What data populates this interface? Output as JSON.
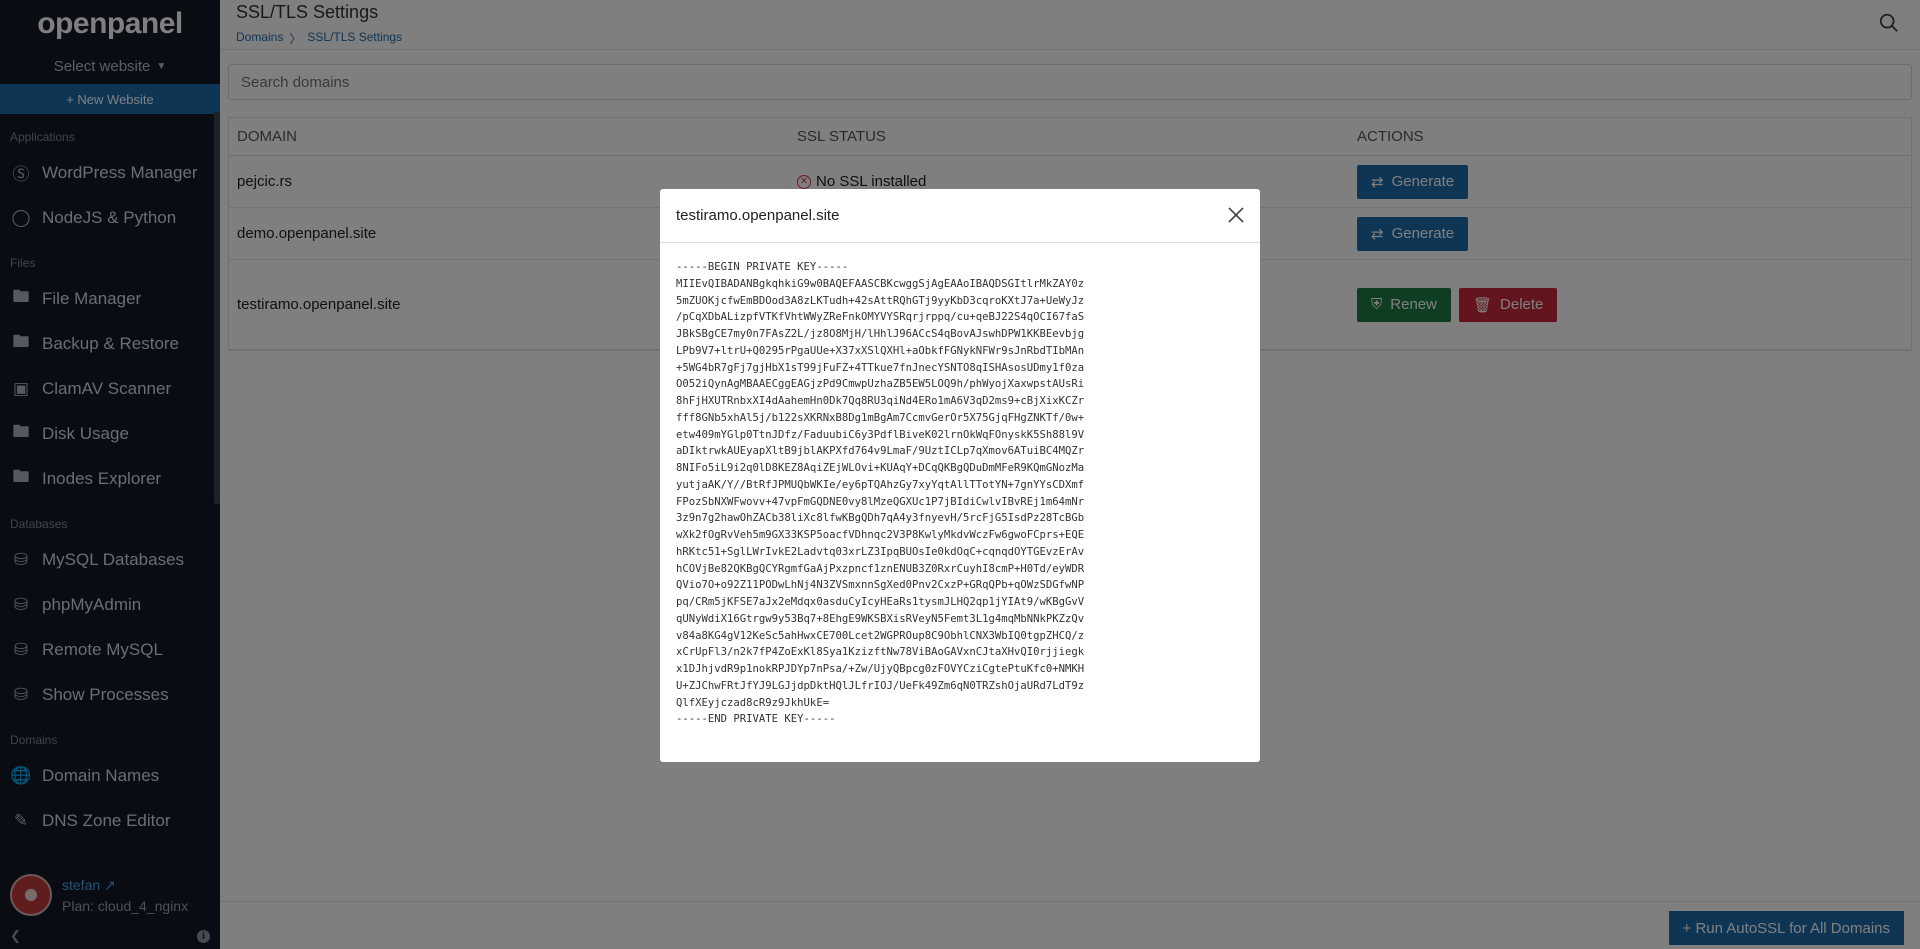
{
  "app": {
    "name": "openpanel"
  },
  "sidebar": {
    "select_label": "Select website",
    "new_website": "+ New Website",
    "sections": [
      {
        "title": "Applications",
        "items": [
          {
            "label": "WordPress Manager",
            "icon": "wordpress-icon"
          },
          {
            "label": "NodeJS & Python",
            "icon": "nodejs-icon"
          }
        ]
      },
      {
        "title": "Files",
        "items": [
          {
            "label": "File Manager",
            "icon": "folder-icon"
          },
          {
            "label": "Backup & Restore",
            "icon": "folder-icon"
          },
          {
            "label": "ClamAV Scanner",
            "icon": "scanner-icon"
          },
          {
            "label": "Disk Usage",
            "icon": "folder-icon"
          },
          {
            "label": "Inodes Explorer",
            "icon": "folder-icon"
          }
        ]
      },
      {
        "title": "Databases",
        "items": [
          {
            "label": "MySQL Databases",
            "icon": "database-icon"
          },
          {
            "label": "phpMyAdmin",
            "icon": "database-icon"
          },
          {
            "label": "Remote MySQL",
            "icon": "database-icon"
          },
          {
            "label": "Show Processes",
            "icon": "database-icon"
          }
        ]
      },
      {
        "title": "Domains",
        "items": [
          {
            "label": "Domain Names",
            "icon": "globe-icon"
          },
          {
            "label": "DNS Zone Editor",
            "icon": "edit-icon"
          }
        ]
      }
    ],
    "user": {
      "name": "stefan",
      "plan": "Plan: cloud_4_nginx"
    }
  },
  "header": {
    "title": "SSL/TLS Settings",
    "breadcrumb": [
      "Domains",
      "SSL/TLS Settings"
    ],
    "breadcrumb_sep": "〉"
  },
  "search": {
    "placeholder": "Search domains"
  },
  "table": {
    "headers": [
      "DOMAIN",
      "SSL STATUS",
      "ACTIONS"
    ],
    "rows": [
      {
        "domain": "pejcic.rs",
        "status": "No SSL installed",
        "actions": [
          "Generate"
        ]
      },
      {
        "domain": "demo.openpanel.site",
        "status": "",
        "actions": [
          "Generate"
        ]
      },
      {
        "domain": "testiramo.openpanel.site",
        "status": "",
        "actions": [
          "Renew",
          "Delete"
        ]
      }
    ]
  },
  "autossl_button": "+ Run AutoSSL for All Domains",
  "modal": {
    "title": "testiramo.openpanel.site",
    "key_lines": [
      "-----BEGIN PRIVATE KEY-----",
      "MIIEvQIBADANBgkqhkiG9w0BAQEFAASCBKcwggSjAgEAAoIBAQDSGItlrMkZAY0z",
      "5mZUOKjcfwEmBDOod3A8zLKTudh+42sAttRQhGTj9yyKbD3cqroKXtJ7a+UeWyJz",
      "/pCqXDbALizpfVTKfVhtWWyZReFnkOMYVYSRqrjrppq/cu+qeBJ22S4qOCI67faS",
      "JBkSBgCE7my0n7FAsZ2L/jz8O8MjH/lHhlJ96ACcS4qBovAJswhDPW1KKBEevbjg",
      "LPb9V7+ltrU+Q0295rPgaUUe+X37xXSlQXHl+aObkfFGNykNFWr9sJnRbdTIbMAn",
      "+5WG4bR7gFj7gjHbX1sT99jFuFZ+4TTkue7fnJnecYSNTO8qISHAsosUDmy1f0za",
      "O052iQynAgMBAAECggEAGjzPd9CmwpUzhaZB5EW5LOQ9h/phWyojXaxwpstAUsRi",
      "8hFjHXUTRnbxXI4dAahemHn0Dk7Qq8RU3qiNd4ERo1mA6V3qD2ms9+cBjXixKCZr",
      "fff8GNb5xhAl5j/b122sXKRNxB8Dg1mBgAm7CcmvGerOr5X75GjqFHgZNKTf/0w+",
      "etw409mYGlp0TtnJDfz/FaduubiC6y3PdflBiveK02lrnOkWqFOnyskK5Sh88l9V",
      "aDIktrwkAUEyapXltB9jblAKPXfd764v9LmaF/9UztICLp7qXmov6ATuiBC4MQZr",
      "8NIFo5iL9i2q0lD8KEZ8AqiZEjWLOvi+KUAqY+DCqQKBgQDuDmMFeR9KQmGNozMa",
      "yutjaAK/Y//BtRfJPMUQbWKIe/ey6pTQAhzGy7xyYqtAllTTotYN+7gnYYsCDXmf",
      "FPozSbNXWFwovv+47vpFmGQDNE0vy8lMzeQGXUc1P7jBIdiCwlvIBvREj1m64mNr",
      "3z9n7g2hawOhZACb38liXc8lfwKBgQDh7qA4y3fnyevH/5rcFjG5IsdPz28TcBGb",
      "wXk2fOgRvVeh5m9GX33KSP5oacfVDhnqc2V3P8KwlyMkdvWczFw6gwoFCprs+EQE",
      "hRKtc51+SglLWrIvkE2Ladvtq03xrLZ3IpqBUOsIe0kdOqC+cqnqdOYTGEvzErAv",
      "hCOVjBe82QKBgQCYRgmfGaAjPxzpncf1znENUB3Z0RxrCuyhI8cmP+H0Td/eyWDR",
      "QVio7O+o92Z11PODwLhNj4N3ZVSmxnnSgXed0Pnv2CxzP+GRqQPb+qOWzSDGfwNP",
      "pq/CRm5jKFSE7aJx2eMdqx0asduCyIcyHEaRs1tysmJLHQ2qp1jYIAt9/wKBgGvV",
      "qUNyWdiX16Gtrgw9y53Bq7+8EhgE9WKSBXisRVeyN5Femt3L1g4mqMbNNkPKZzQv",
      "v84a8KG4gV12KeSc5ahHwxCE700Lcet2WGPROup8C9ObhlCNX3WbIQ0tgpZHCQ/z",
      "xCrUpFl3/n2k7fP4ZoExKl8Sya1KzizftNw78ViBAoGAVxnCJtaXHvQI0rjjiegk",
      "x1DJhjvdR9p1nokRPJDYp7nPsa/+Zw/UjyQBpcg0zFOVYCziCgtePtuKfc0+NMKH",
      "U+ZJChwFRtJfYJ9LGJjdpDktHQlJLfrIOJ/UeFk49Zm6qN0TRZshOjaURd7LdT9z",
      "QlfXEyjczad8cR9z9JkhUkE=",
      "-----END PRIVATE KEY-----"
    ]
  },
  "colors": {
    "primary": "#1e6aa8",
    "success": "#1f7a43",
    "danger": "#c8283a",
    "sidebar_bg": "#121a26"
  }
}
